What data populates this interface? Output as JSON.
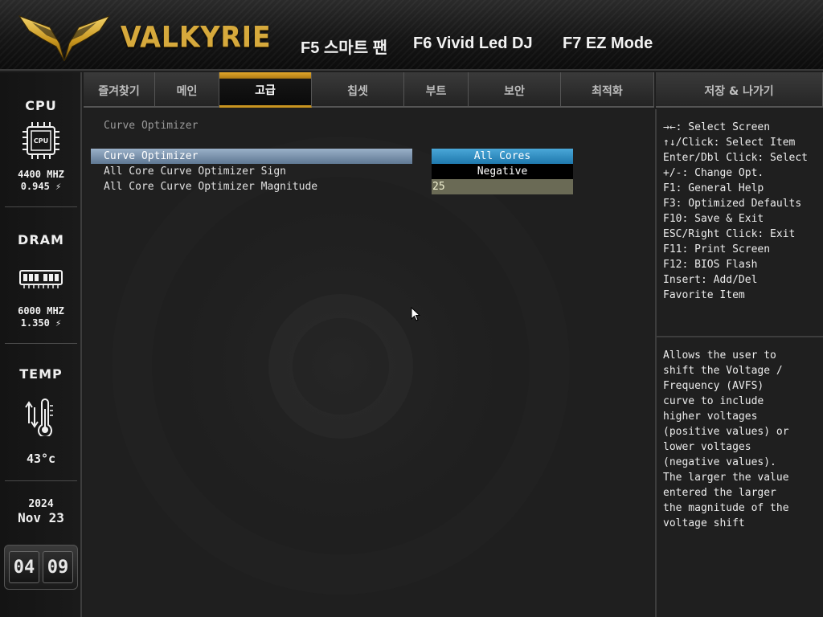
{
  "header": {
    "brand": "VALKYRIE",
    "fkeys": [
      "F5 스마트 팬",
      "F6 Vivid Led DJ",
      "F7 EZ Mode"
    ]
  },
  "sidebar": {
    "cpu": {
      "title": "CPU",
      "chip_label": "CPU",
      "freq": "4400 MHZ",
      "volt": "0.945 ⚡"
    },
    "dram": {
      "title": "DRAM",
      "freq": "6000 MHZ",
      "volt": "1.350 ⚡"
    },
    "temp": {
      "title": "TEMP",
      "value": "43°c"
    },
    "date": {
      "year": "2024",
      "day": "Nov 23"
    },
    "clock": {
      "hours": "04",
      "minutes": "09"
    }
  },
  "tabs": [
    {
      "label": "즐겨찾기",
      "active": false
    },
    {
      "label": "메인",
      "active": false
    },
    {
      "label": "고급",
      "active": true
    },
    {
      "label": "칩셋",
      "active": false
    },
    {
      "label": "부트",
      "active": false
    },
    {
      "label": "보안",
      "active": false
    },
    {
      "label": "최적화",
      "active": false
    },
    {
      "label": "저장 & 나가기",
      "active": false
    }
  ],
  "main": {
    "heading": "Curve Optimizer",
    "settings": [
      {
        "label": "Curve Optimizer",
        "value": "All Cores"
      },
      {
        "label": "All Core Curve Optimizer Sign",
        "value": "Negative"
      },
      {
        "label": "All Core Curve Optimizer Magnitude",
        "value": "25"
      }
    ]
  },
  "help": {
    "keys": [
      "→←: Select Screen",
      "↑↓/Click: Select Item",
      "Enter/Dbl Click: Select",
      "+/-: Change Opt.",
      "F1: General Help",
      "F3: Optimized Defaults",
      "F10: Save & Exit",
      "ESC/Right Click: Exit",
      "F11: Print Screen",
      "F12: BIOS Flash",
      "Insert: Add/Del",
      "Favorite Item"
    ],
    "description": [
      "Allows the user to",
      "shift the Voltage /",
      "Frequency (AVFS)",
      "curve to include",
      "higher voltages",
      "(positive values) or",
      "lower voltages",
      "(negative values).",
      "The larger the value",
      "entered the larger",
      "the magnitude of the",
      "voltage shift"
    ]
  },
  "colors": {
    "accent_gold": "#d6a93c",
    "selected_row": "#7f97b2",
    "option_blue": "#2f8fc6",
    "numeric_field": "#6a6a55"
  }
}
